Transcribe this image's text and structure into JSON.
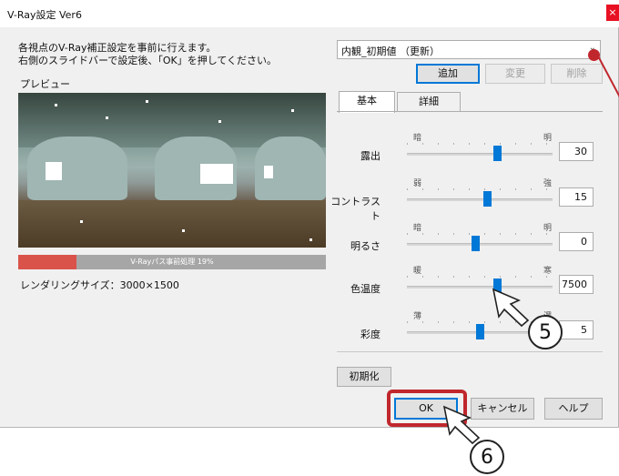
{
  "window": {
    "title": "V-Ray設定 Ver6",
    "close_label": "×"
  },
  "hint": {
    "line1": "各視点のV-Ray補正設定を事前に行えます。",
    "line2": "右側のスライドバーで設定後、「OK」を押してください。"
  },
  "preview": {
    "label": "プレビュー",
    "progress_text": "V-Rayパス事前処理 19%",
    "progress_fraction": 0.19
  },
  "render_size": "レンダリングサイズ：3000×1500",
  "preset": {
    "selected": "内観_初期値 （更新）",
    "add_label": "追加",
    "change_label": "変更",
    "delete_label": "削除"
  },
  "tabs": {
    "basic": "基本",
    "detail": "詳細"
  },
  "sliders": [
    {
      "label": "露出",
      "min": "暗",
      "max": "明",
      "value": "30",
      "position": 0.62
    },
    {
      "label": "コントラスト",
      "min": "弱",
      "max": "強",
      "value": "15",
      "position": 0.55
    },
    {
      "label": "明るさ",
      "min": "暗",
      "max": "明",
      "value": "0",
      "position": 0.47
    },
    {
      "label": "色温度",
      "min": "暖",
      "max": "寒",
      "value": "7500",
      "position": 0.62
    },
    {
      "label": "彩度",
      "min": "薄",
      "max": "濃",
      "value": "5",
      "position": 0.5
    }
  ],
  "buttons": {
    "reset": "初期化",
    "ok": "OK",
    "cancel": "キャンセル",
    "help": "ヘルプ"
  },
  "callouts": {
    "five": "5",
    "six": "6"
  },
  "colors": {
    "accent": "#0078d7",
    "highlight": "#c0272d",
    "progress": "#d9534b"
  }
}
